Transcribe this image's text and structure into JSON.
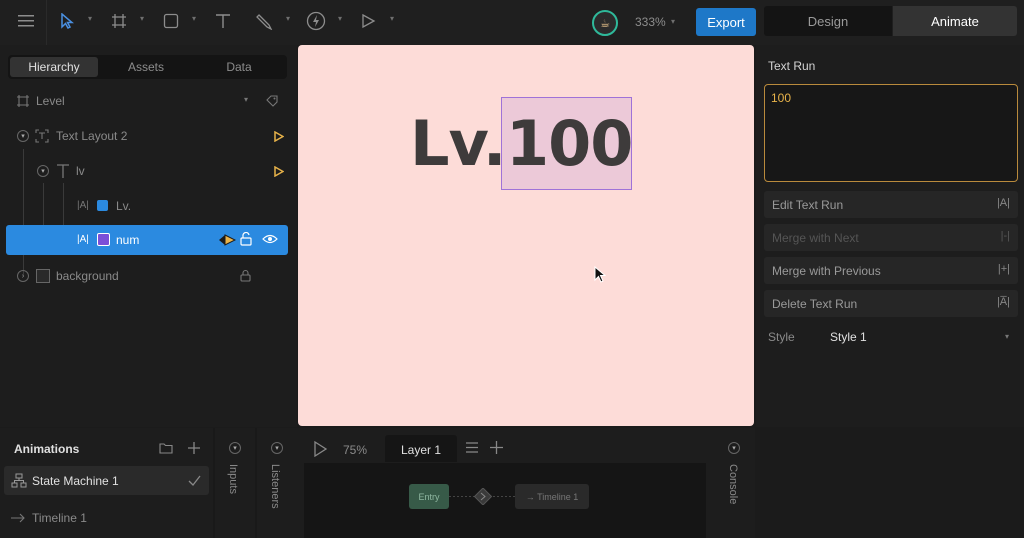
{
  "toolbar": {
    "zoom": "333%",
    "export_label": "Export",
    "mode_design": "Design",
    "mode_animate": "Animate",
    "tools": [
      "menu-icon",
      "select-icon",
      "frame-icon",
      "shape-icon",
      "text-icon",
      "pen-icon",
      "bone-icon",
      "play-icon"
    ]
  },
  "left_panel": {
    "tabs": [
      "Hierarchy",
      "Assets",
      "Data"
    ],
    "active_tab": "Hierarchy",
    "artboard_name": "Level",
    "items": [
      {
        "label": "Text Layout 2",
        "icon": "text-layout-icon"
      },
      {
        "label": "lv",
        "icon": "text-icon"
      },
      {
        "label": "Lv.",
        "icon": "text-run-icon",
        "swatch": "#2b8ae0"
      },
      {
        "label": "num",
        "icon": "text-run-icon",
        "swatch": "#7b4fd8",
        "selected": true
      },
      {
        "label": "background",
        "icon": "rect-icon"
      }
    ]
  },
  "canvas": {
    "lv_text": "Lv.",
    "num_text": "100",
    "background": "#fddcd8",
    "text_color": "#3e3b3b"
  },
  "right_panel": {
    "title": "Text Run",
    "text_value": "100",
    "buttons": [
      {
        "label": "Edit Text Run",
        "icon": "|A|",
        "disabled": false
      },
      {
        "label": "Merge with Next",
        "icon": "|-|",
        "disabled": true
      },
      {
        "label": "Merge with Previous",
        "icon": "|+|",
        "disabled": false
      },
      {
        "label": "Delete Text Run",
        "icon": "|A̅|",
        "disabled": false
      }
    ],
    "style_label": "Style",
    "style_value": "Style 1"
  },
  "bottom": {
    "animations_title": "Animations",
    "state_machine": "State Machine 1",
    "timeline": "Timeline 1",
    "inputs_label": "Inputs",
    "listeners_label": "Listeners",
    "graph_zoom": "75%",
    "layer_label": "Layer 1",
    "entry_node": "Entry",
    "timeline_node": "→ Timeline 1",
    "console_label": "Console"
  },
  "colors": {
    "accent": "#1e78c8",
    "selection": "#2b8ae0",
    "text_run_border": "#b98a3c",
    "num_highlight": "#9f72d8"
  }
}
